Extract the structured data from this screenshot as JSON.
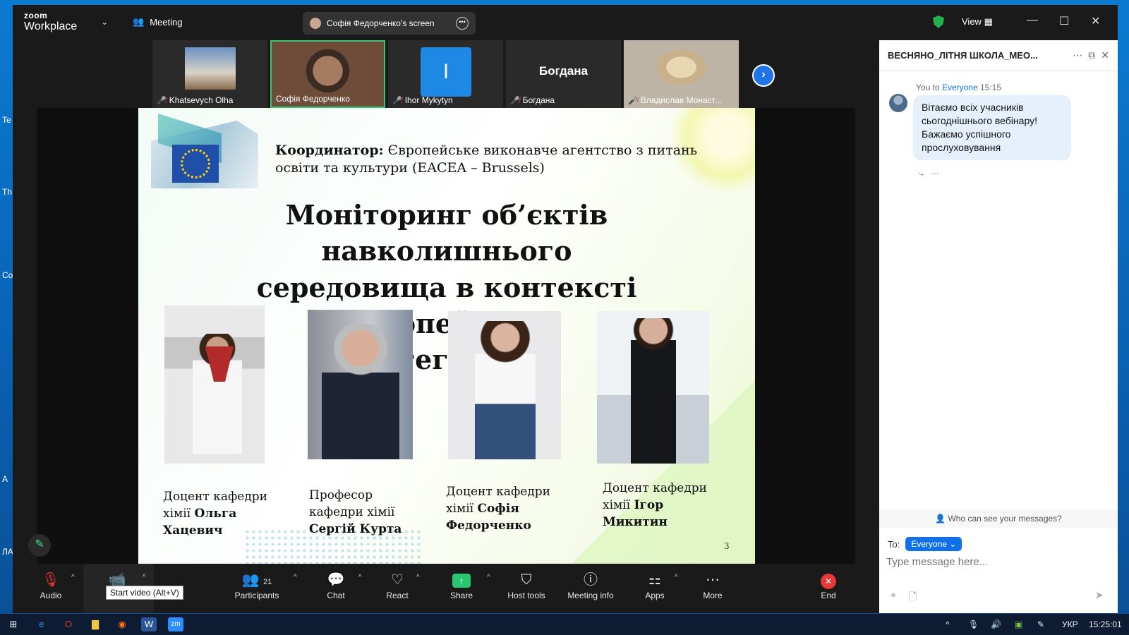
{
  "desktop": {
    "side_labels": [
      "Te",
      "Th",
      "Co",
      "А",
      "ЛА"
    ]
  },
  "titlebar": {
    "brand_top": "zoom",
    "brand_bottom": "Workplace",
    "meeting_label": "Meeting",
    "screen_share_label": "Софія Федорченко's screen",
    "view_label": "View"
  },
  "participants": [
    {
      "name": "Khatsevych Olha",
      "muted": true
    },
    {
      "name": "Софія Федорченко",
      "muted": false,
      "active": true
    },
    {
      "name": "Ihor Mykytyn",
      "muted": true,
      "tile_text": "I"
    },
    {
      "name": "Богдана",
      "muted": true,
      "tile_text": "Богдана"
    },
    {
      "name": "Владислав Монаст...",
      "muted": true
    }
  ],
  "slide": {
    "coord_label": "Координатор:",
    "coord_text": " Європейське виконавче агентство з питань освіти та культури (EACEA – Brussels)",
    "title_line1": "Моніторинг об’єктів навколишнього",
    "title_line2": "середовища в контексті Європейської",
    "title_line3": "інтеграції",
    "captions": [
      {
        "plain": "Доцент кафедри хімії ",
        "bold": "Ольга Хацевич"
      },
      {
        "plain": "Професор кафедри хімії ",
        "bold": "Сергій Курта"
      },
      {
        "plain": "Доцент кафедри хімії ",
        "bold": "Софія Федорченко"
      },
      {
        "plain": "Доцент кафедри хімії ",
        "bold": "Ігор Микитин"
      }
    ],
    "page_number": "3"
  },
  "toolbar": {
    "audio": "Audio",
    "video": "Vid",
    "video_tooltip": "Start video (Alt+V)",
    "participants": "Participants",
    "participants_count": "21",
    "chat": "Chat",
    "react": "React",
    "share": "Share",
    "host_tools": "Host tools",
    "meeting_info": "Meeting info",
    "apps": "Apps",
    "more": "More",
    "end": "End"
  },
  "chat": {
    "title": "ВЕСНЯНО_ЛІТНЯ ШКОЛА_МЕО...",
    "msg_from": "You to ",
    "msg_to": "Everyone",
    "msg_time": " 15:15",
    "msg_text": "Вітаємо всіх учасників сьогоднішнього вебінару! Бажаємо успішного прослуховування",
    "who_can_see": "Who can see your messages?",
    "to_label": "To:",
    "to_value": "Everyone",
    "input_placeholder": "Type message here..."
  },
  "taskbar": {
    "lang": "УКР",
    "clock": "15:25:01"
  },
  "colors": {
    "accent": "#0e71eb",
    "active_border": "#2ecc71",
    "end_red": "#e53935",
    "share_green": "#28c76f"
  }
}
